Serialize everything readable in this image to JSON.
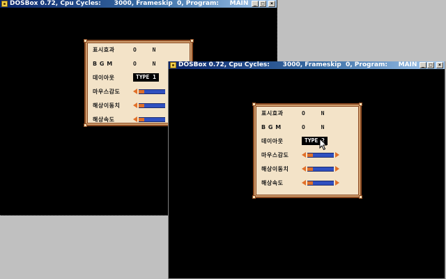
{
  "titlebar": {
    "title": "DOSBox 0.72, Cpu Cycles:      3000, Frameskip  0, Program:     MAIN",
    "minimize": "_",
    "maximize": "□",
    "close": "×"
  },
  "settings": {
    "effects": {
      "label": "표시효과",
      "value": "O N"
    },
    "bgm": {
      "label": "B G M",
      "value": "O N"
    },
    "layout": {
      "label": "데이아웃",
      "value_back": "TYPE 1",
      "value_front": "TYPE 2"
    },
    "mouse_sensitivity": {
      "label": "마우스감도",
      "level": 0.2
    },
    "resolution_move": {
      "label": "해상이동치",
      "level": 0.2
    },
    "resolution_speed": {
      "label": "해상속도",
      "level": 0.2
    }
  },
  "colors": {
    "titlebar_start": "#0a246a",
    "panel_bg": "#f3e3c8",
    "panel_border": "#8a4a22",
    "slider_fill": "#e0702a",
    "slider_track": "#3050c0"
  }
}
